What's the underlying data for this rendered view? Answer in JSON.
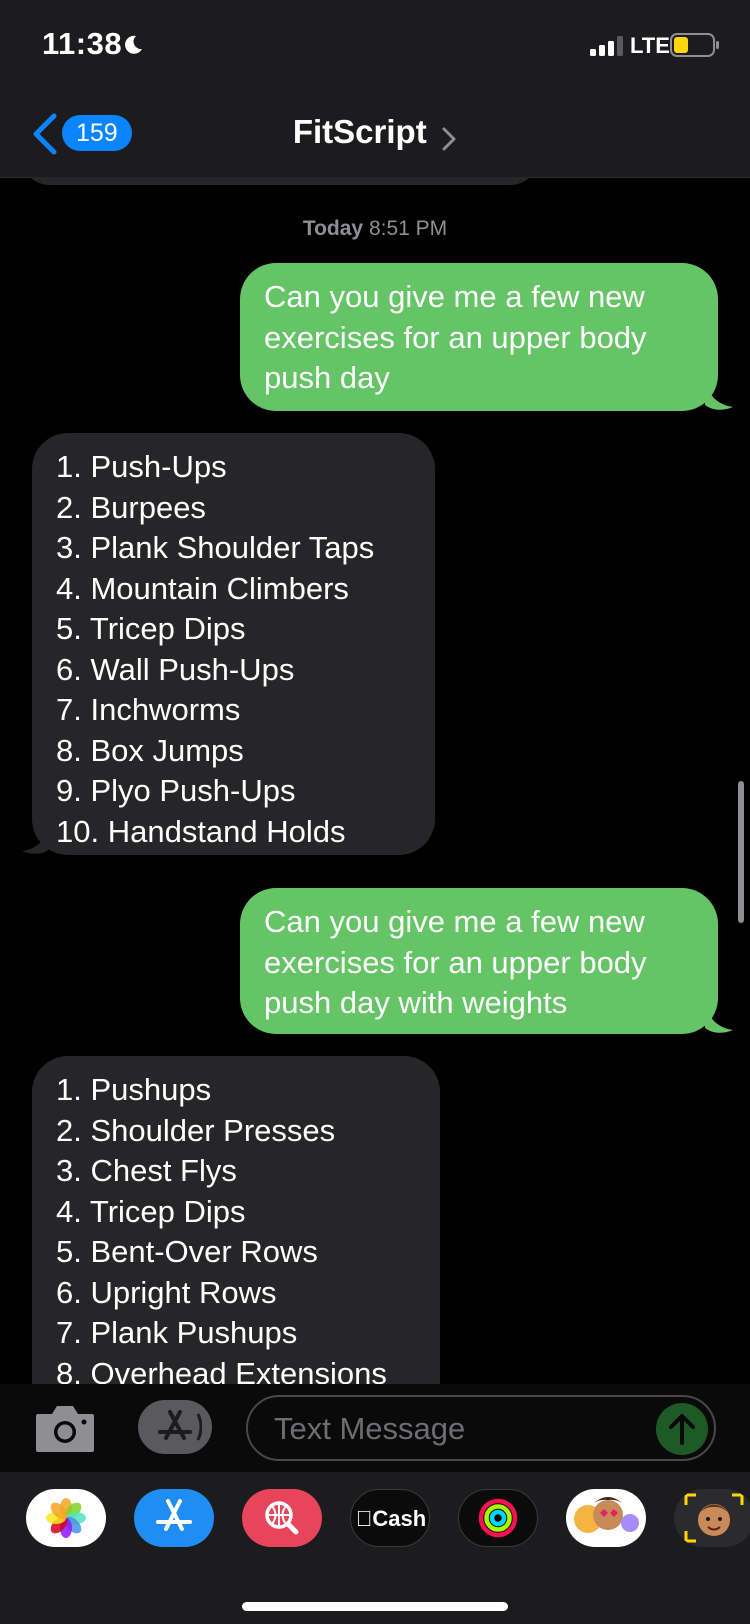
{
  "status_bar": {
    "time": "11:38",
    "network": "LTE",
    "battery_color": "#ffd60a"
  },
  "nav": {
    "back_count": "159",
    "title": "FitScript"
  },
  "conversation": {
    "timestamp_day": "Today",
    "timestamp_time": "8:51 PM",
    "messages": [
      {
        "from": "me",
        "lines": [
          "Can you give me a few new",
          "exercises for an upper body",
          "push day"
        ]
      },
      {
        "from": "them",
        "lines": [
          "1. Push-Ups",
          "2. Burpees",
          "3. Plank Shoulder Taps",
          "4. Mountain Climbers",
          "5. Tricep Dips",
          "6. Wall Push-Ups",
          "7. Inchworms",
          "8. Box Jumps",
          "9. Plyo Push-Ups",
          "10. Handstand Holds"
        ]
      },
      {
        "from": "me",
        "lines": [
          "Can you give me a few new",
          "exercises for an upper body",
          "push day with weights"
        ]
      },
      {
        "from": "them",
        "lines": [
          "1. Pushups",
          "2. Shoulder Presses",
          "3. Chest Flys",
          "4. Tricep Dips",
          "5. Bent-Over Rows",
          "6. Upright Rows",
          "7. Plank Pushups",
          "8. Overhead Extensions"
        ]
      }
    ]
  },
  "input": {
    "placeholder": "Text Message"
  },
  "app_tray": {
    "apps": [
      {
        "name": "photos-app",
        "icon": "photos-icon"
      },
      {
        "name": "app-store-app",
        "icon": "app-store-icon"
      },
      {
        "name": "image-search-app",
        "icon": "globe-search-icon"
      },
      {
        "name": "cash-app",
        "icon": "apple-cash-icon",
        "label": "Cash"
      },
      {
        "name": "activity-app",
        "icon": "activity-rings-icon"
      },
      {
        "name": "memoji-app",
        "icon": "memoji-icon"
      },
      {
        "name": "memoji-stickers-app",
        "icon": "memoji-face-icon"
      }
    ]
  },
  "colors": {
    "outgoing_bubble": "#65c466",
    "incoming_bubble": "#262628",
    "accent": "#0a84ff"
  }
}
